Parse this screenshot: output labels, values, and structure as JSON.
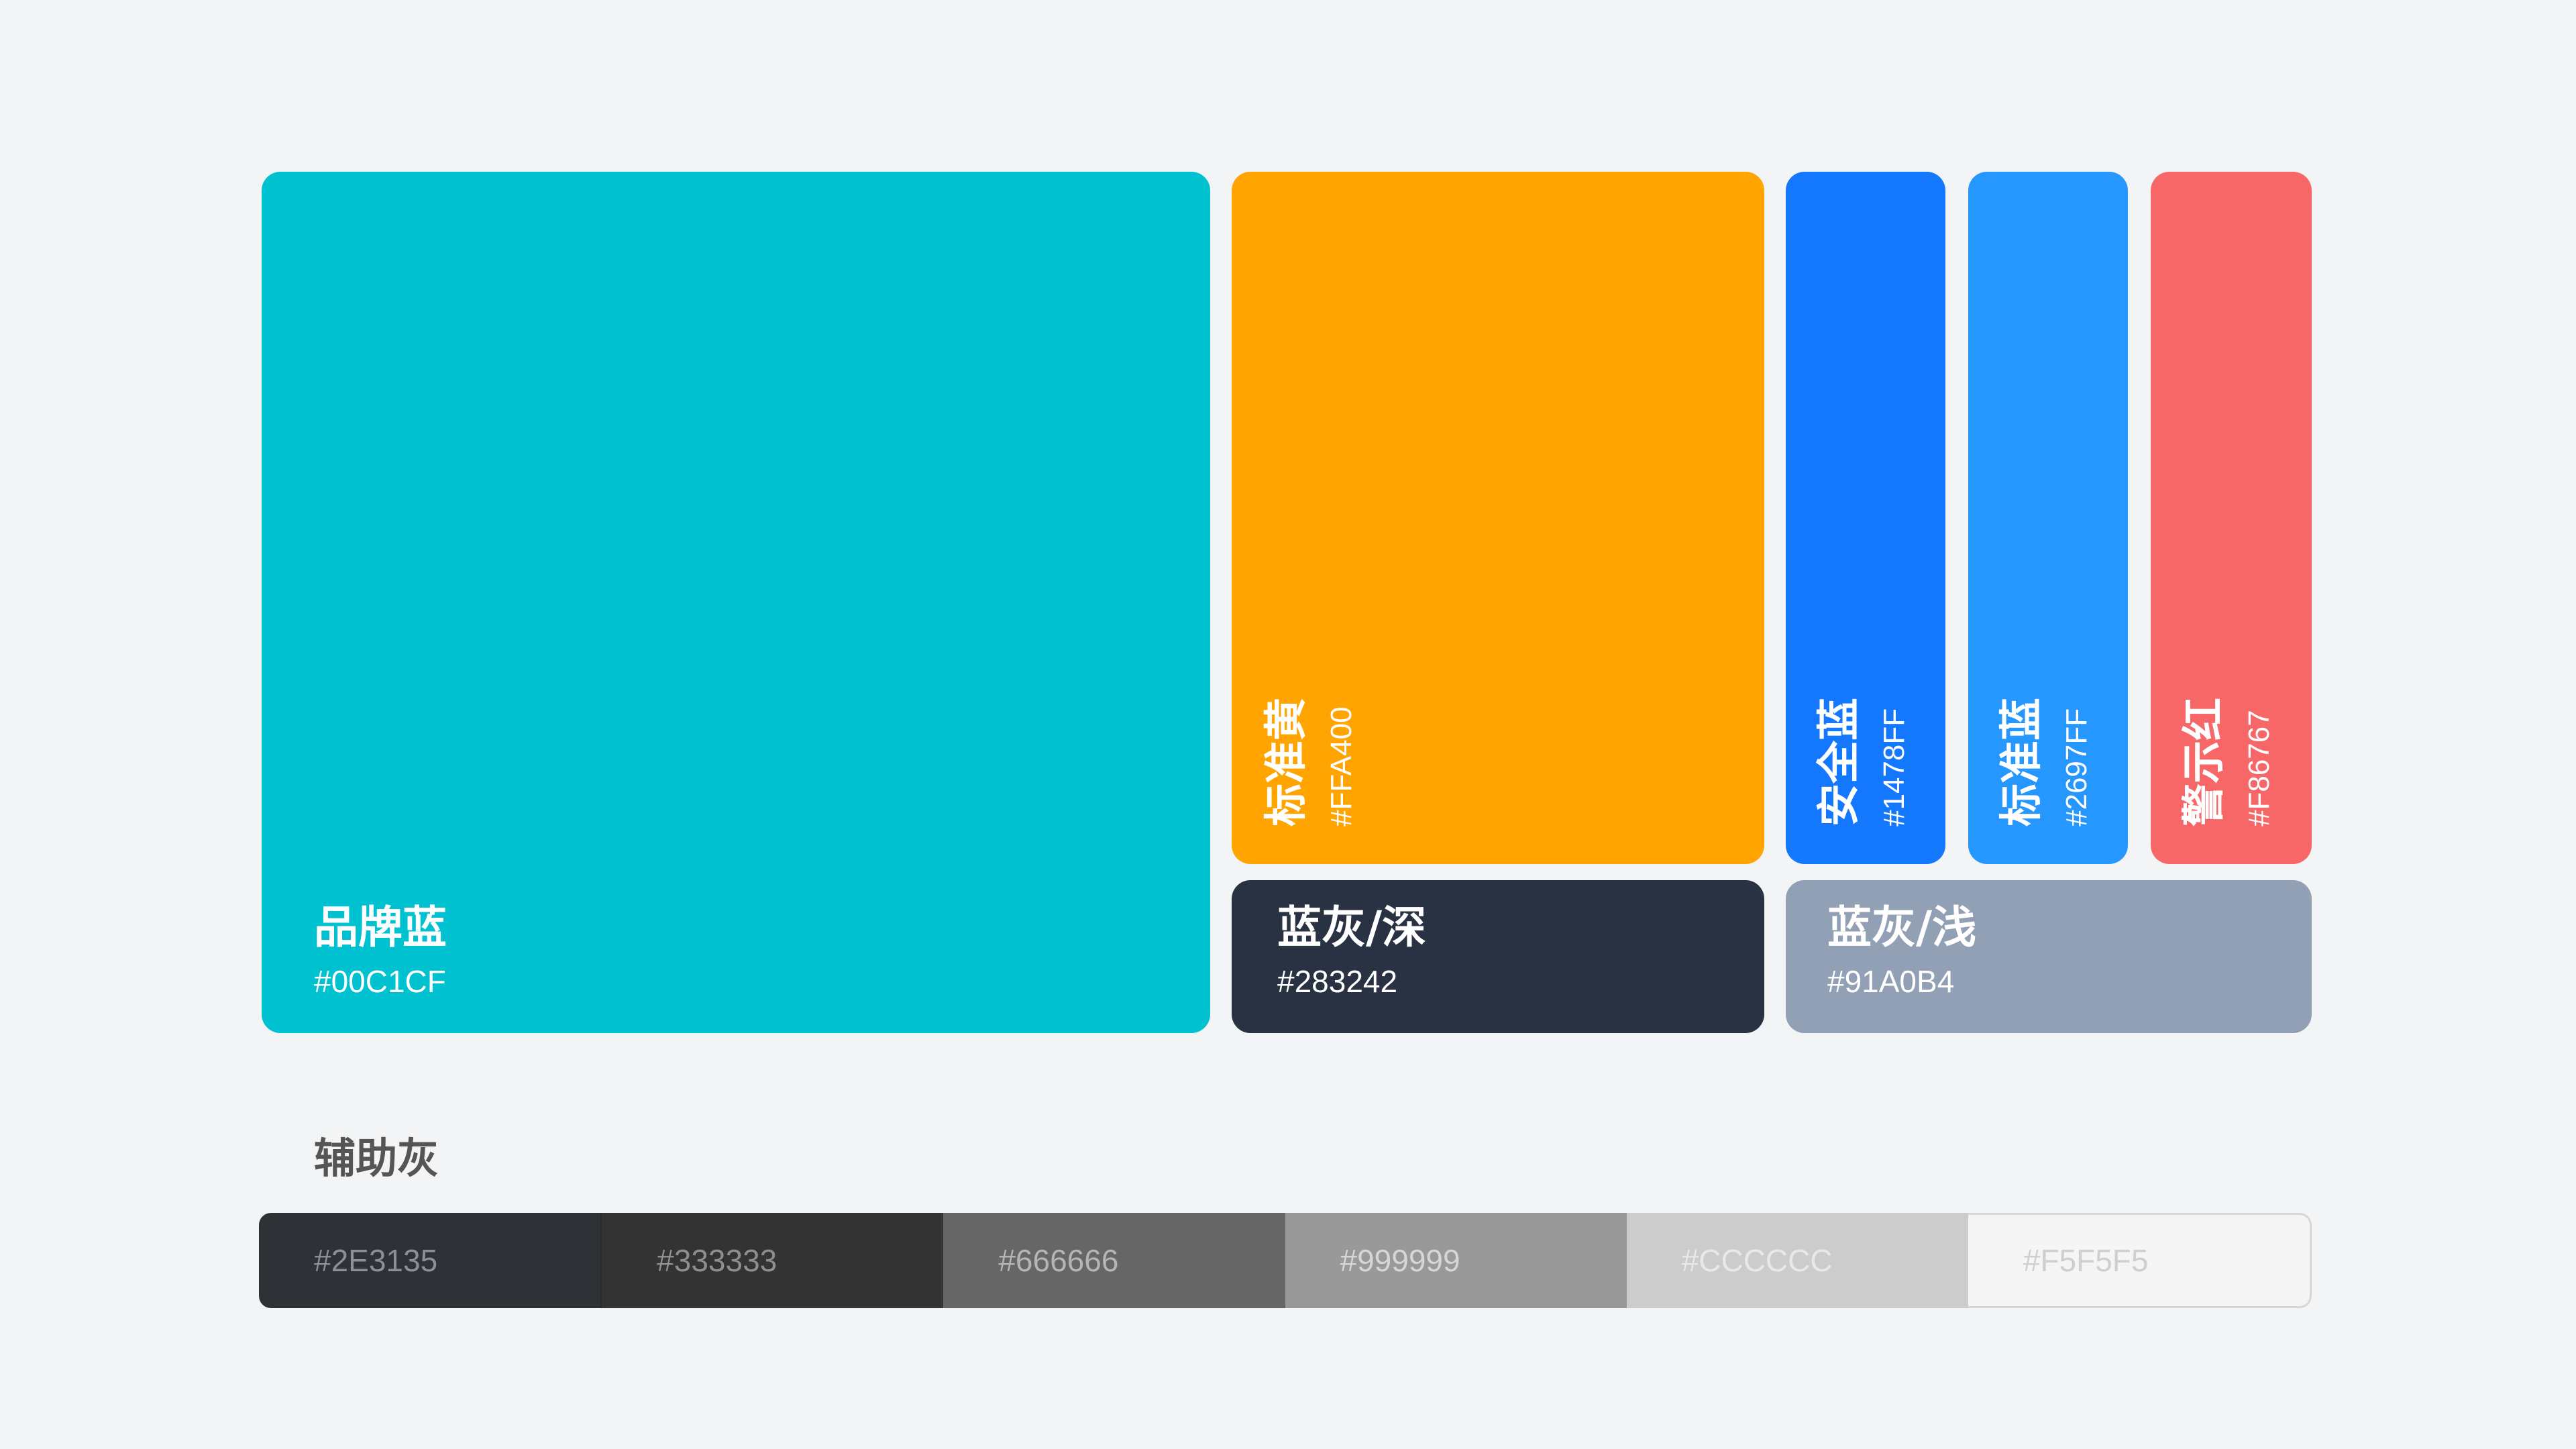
{
  "swatches": {
    "brand_blue": {
      "name": "品牌蓝",
      "hex": "#00C1CF",
      "color": "#00C1CF"
    },
    "standard_yellow": {
      "name": "标准黄",
      "hex": "#FFA400",
      "color": "#FFA400"
    },
    "safe_blue": {
      "name": "安全蓝",
      "hex": "#1478FF",
      "color": "#1478FF"
    },
    "standard_blue": {
      "name": "标准蓝",
      "hex": "#2697FF",
      "color": "#2697FF"
    },
    "warning_red": {
      "name": "警示红",
      "hex": "#F86767",
      "color": "#F86767"
    },
    "blue_gray_dark": {
      "name": "蓝灰/深",
      "hex": "#283242",
      "color": "#283242"
    },
    "blue_gray_light": {
      "name": "蓝灰/浅",
      "hex": "#91A0B4",
      "color": "#91A0B4"
    }
  },
  "auxiliary": {
    "title": "辅助灰",
    "grays": [
      {
        "hex": "#2E3135",
        "color": "#2E3135"
      },
      {
        "hex": "#333333",
        "color": "#333333"
      },
      {
        "hex": "#666666",
        "color": "#666666"
      },
      {
        "hex": "#999999",
        "color": "#999999"
      },
      {
        "hex": "#CCCCCC",
        "color": "#CCCCCC"
      },
      {
        "hex": "#F5F5F5",
        "color": "#F5F5F5"
      }
    ]
  }
}
